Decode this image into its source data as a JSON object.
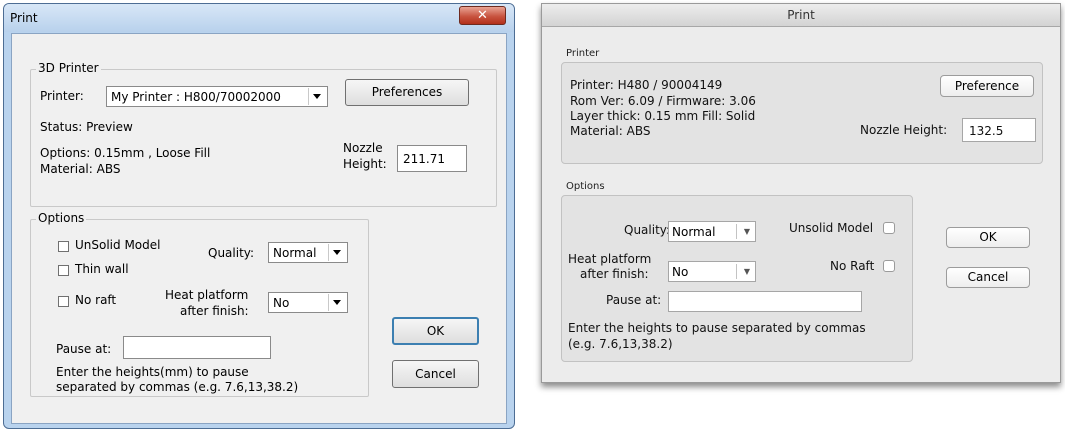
{
  "win": {
    "title": "Print",
    "close_glyph": "✕",
    "printer_group": {
      "legend": "3D Printer",
      "printer_label": "Printer:",
      "printer_value": "My Printer : H800/70002000",
      "preferences_button": "Preferences",
      "status": "Status: Preview",
      "options_line": "Options: 0.15mm , Loose Fill",
      "material_line": "Material: ABS",
      "nozzle_label_1": "Nozzle",
      "nozzle_label_2": "Height:",
      "nozzle_value": "211.71"
    },
    "options_group": {
      "legend": "Options",
      "unsolid_label": "UnSolid Model",
      "thin_wall_label": "Thin wall",
      "no_raft_label": "No raft",
      "quality_label": "Quality:",
      "quality_value": "Normal",
      "heat_label_1": "Heat platform",
      "heat_label_2": "after finish:",
      "heat_value": "No",
      "pause_label": "Pause at:",
      "pause_value": "",
      "hint_1": "Enter the heights(mm) to pause",
      "hint_2": "separated by commas (e.g. 7.6,13,38.2)"
    },
    "ok_button": "OK",
    "cancel_button": "Cancel"
  },
  "mac": {
    "title": "Print",
    "printer_section_label": "Printer",
    "printer_line": "Printer: H480 / 90004149",
    "rom_line": "Rom Ver: 6.09 / Firmware: 3.06",
    "layer_line": "Layer thick: 0.15 mm  Fill: Solid",
    "material_line": "Material: ABS",
    "preference_button": "Preference",
    "nozzle_label": "Nozzle Height:",
    "nozzle_value": "132.5",
    "options_section_label": "Options",
    "quality_label": "Quality:",
    "quality_value": "Normal",
    "unsolid_label": "Unsolid Model",
    "heat_label_1": "Heat platform",
    "heat_label_2": "after finish:",
    "heat_value": "No",
    "no_raft_label": "No Raft",
    "pause_label": "Pause at:",
    "pause_value": "",
    "hint_1": "Enter the heights to pause separated by commas",
    "hint_2": "(e.g. 7.6,13,38.2)",
    "ok_button": "OK",
    "cancel_button": "Cancel",
    "popup_arrow": "▼"
  }
}
